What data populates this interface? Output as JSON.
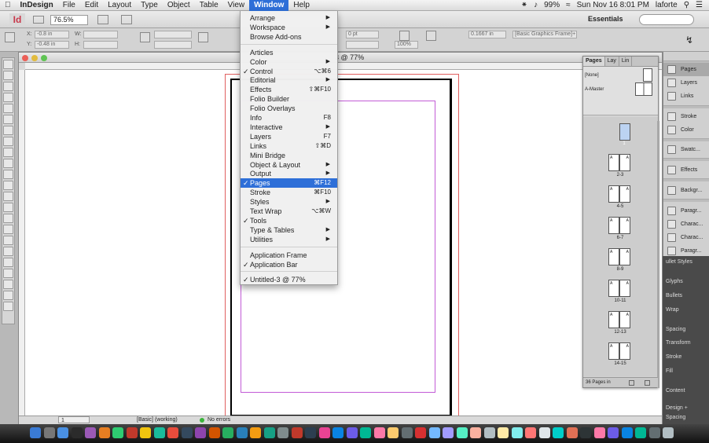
{
  "menubar": {
    "apple": "",
    "items": [
      {
        "label": "InDesign",
        "bold": true
      },
      {
        "label": "File"
      },
      {
        "label": "Edit"
      },
      {
        "label": "Layout"
      },
      {
        "label": "Type"
      },
      {
        "label": "Object"
      },
      {
        "label": "Table"
      },
      {
        "label": "View"
      },
      {
        "label": "Window",
        "active": true
      },
      {
        "label": "Help"
      }
    ],
    "battery": "99%",
    "datetime": "Sun Nov 16  8:01 PM",
    "user": "laforte"
  },
  "appbar": {
    "logo": "Id",
    "zoom": "76.5%",
    "workspace": "Essentials"
  },
  "control": {
    "x_label": "X:",
    "x_value": "-0.8 in",
    "y_label": "Y:",
    "y_value": "-0.48 in",
    "w_label": "W:",
    "h_label": "H:",
    "stroke_weight": "0 pt",
    "scale": "100%",
    "inset": "0.1667 in",
    "object_style": "[Basic Graphics Frame]+"
  },
  "menu": {
    "items": [
      {
        "label": "Arrange",
        "submenu": true
      },
      {
        "label": "Workspace",
        "submenu": true
      },
      {
        "label": "Browse Add-ons"
      },
      {
        "sep": true
      },
      {
        "label": "Articles"
      },
      {
        "label": "Color",
        "submenu": true
      },
      {
        "label": "Control",
        "checked": true,
        "shortcut": "⌥⌘6"
      },
      {
        "label": "Editorial",
        "submenu": true
      },
      {
        "label": "Effects",
        "shortcut": "⇧⌘F10"
      },
      {
        "label": "Folio Builder"
      },
      {
        "label": "Folio Overlays"
      },
      {
        "label": "Info",
        "shortcut": "F8"
      },
      {
        "label": "Interactive",
        "submenu": true
      },
      {
        "label": "Layers",
        "shortcut": "F7"
      },
      {
        "label": "Links",
        "shortcut": "⇧⌘D"
      },
      {
        "label": "Mini Bridge"
      },
      {
        "label": "Object & Layout",
        "submenu": true
      },
      {
        "label": "Output",
        "submenu": true
      },
      {
        "label": "Pages",
        "checked": true,
        "shortcut": "⌘F12",
        "selected": true
      },
      {
        "label": "Stroke",
        "shortcut": "⌘F10"
      },
      {
        "label": "Styles",
        "submenu": true
      },
      {
        "label": "Text Wrap",
        "shortcut": "⌥⌘W"
      },
      {
        "label": "Tools",
        "checked": true
      },
      {
        "label": "Type & Tables",
        "submenu": true
      },
      {
        "label": "Utilities",
        "submenu": true
      },
      {
        "sep": true
      },
      {
        "label": "Application Frame"
      },
      {
        "label": "Application Bar",
        "checked": true
      },
      {
        "sep": true
      },
      {
        "label": "Untitled-3 @ 77%",
        "checked": true
      }
    ]
  },
  "document": {
    "title": "3 @ 77%",
    "page_field": "1",
    "style": "[Basic] (working)",
    "errors": "No errors"
  },
  "pages_panel": {
    "tabs": [
      "Pages",
      "Lay",
      "Lin"
    ],
    "masters": [
      "[None]",
      "A-Master"
    ],
    "spreads": [
      "1",
      "2-3",
      "4-5",
      "6-7",
      "8-9",
      "10-11",
      "12-13",
      "14-15"
    ],
    "page_letter": "A",
    "footer": "36 Pages in"
  },
  "dock": {
    "items": [
      "Pages",
      "Layers",
      "Links",
      "Stroke",
      "Color",
      "Swatc...",
      "Effects",
      "Backgr...",
      "Paragr...",
      "Charac...",
      "Charac...",
      "Paragr..."
    ],
    "dark_items": [
      "ullet Styles",
      "Glyphs",
      "Bullets",
      "Wrap",
      "Spacing",
      "Transform",
      "Stroke",
      "Fill",
      "Content",
      "Design +",
      "Spacing"
    ]
  }
}
